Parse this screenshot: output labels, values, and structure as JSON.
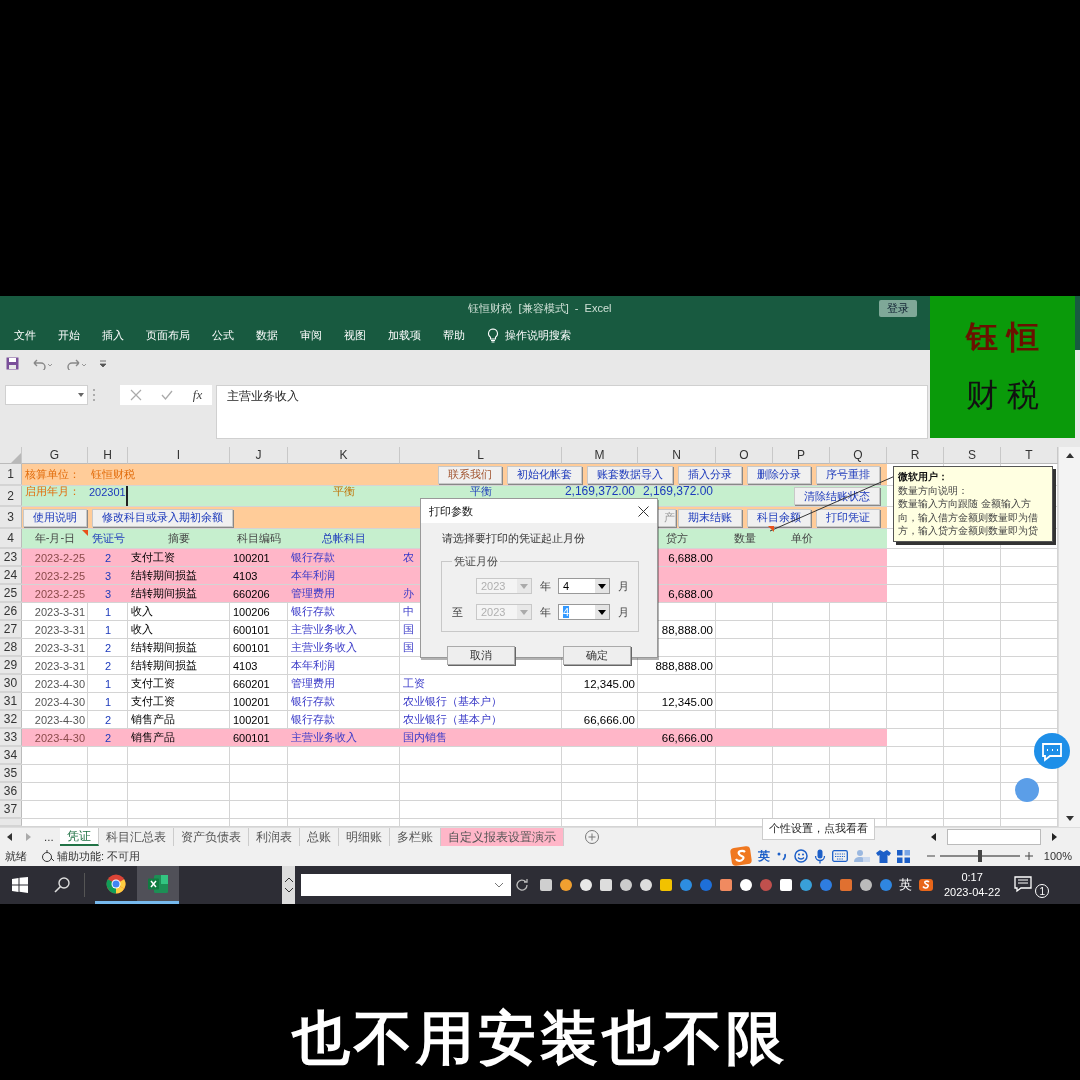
{
  "title_bar": {
    "title": "钰恒财税  [兼容模式]  -  Excel",
    "login": "登录"
  },
  "menu": {
    "items": [
      "文件",
      "开始",
      "插入",
      "页面布局",
      "公式",
      "数据",
      "审阅",
      "视图",
      "加载项",
      "帮助"
    ],
    "tell_me": "操作说明搜索"
  },
  "logo": {
    "line1": "钰 恒",
    "line2": "财 税"
  },
  "formula_bar": {
    "fx": "fx",
    "formula": "主营业务收入"
  },
  "columns": [
    "G",
    "H",
    "I",
    "J",
    "K",
    "L",
    "M",
    "N",
    "O",
    "P",
    "Q",
    "R",
    "S",
    "T"
  ],
  "row1": {
    "number": "1",
    "label": "核算单位：",
    "value": "钰恒财税",
    "buttons": [
      "联系我们",
      "初始化帐套",
      "账套数据导入",
      "插入分录",
      "删除分录",
      "序号重排"
    ]
  },
  "row2": {
    "number": "2",
    "label": "启用年月：",
    "value": "202301",
    "balance_k": "平衡",
    "balance_l": "平衡",
    "debit_total": "2,169,372.00",
    "credit_total": "2,169,372.00",
    "button": "清除结账状态"
  },
  "row3": {
    "number": "3",
    "left_buttons": [
      "使用说明",
      "修改科目或录入期初余额"
    ],
    "right_buttons": [
      "产",
      "期末结账",
      "科目余额",
      "打印凭证"
    ]
  },
  "row4": {
    "number": "4",
    "headers_left": [
      {
        "text": "年-月-日",
        "kind": "plain"
      },
      {
        "text": "凭证号",
        "kind": "link"
      },
      {
        "text": "摘要",
        "kind": "plain"
      },
      {
        "text": "科目编码",
        "kind": "plain"
      },
      {
        "text": "总帐科目",
        "kind": "link"
      }
    ],
    "headers_right": [
      {
        "text": "贷方",
        "kind": "plain"
      },
      {
        "text": "数量",
        "kind": "plain"
      },
      {
        "text": "单价",
        "kind": "plain"
      }
    ]
  },
  "entries": [
    {
      "number": "23",
      "highlighted": true,
      "date": "2023-2-25",
      "voucher": "2",
      "summary": "支付工资",
      "code": "100201",
      "account": "银行存款",
      "detail": "农",
      "credit": "6,688.00"
    },
    {
      "number": "24",
      "highlighted": true,
      "date": "2023-2-25",
      "voucher": "3",
      "summary": "结转期间损益",
      "code": "4103",
      "account": "本年利润"
    },
    {
      "number": "25",
      "highlighted": true,
      "date": "2023-2-25",
      "voucher": "3",
      "summary": "结转期间损益",
      "code": "660206",
      "account": "管理费用",
      "detail": "办",
      "credit": "6,688.00"
    },
    {
      "number": "26",
      "highlighted": false,
      "date": "2023-3-31",
      "voucher": "1",
      "summary": "收入",
      "code": "100206",
      "account": "银行存款",
      "detail": "中"
    },
    {
      "number": "27",
      "highlighted": false,
      "date": "2023-3-31",
      "voucher": "1",
      "summary": "收入",
      "code": "600101",
      "account": "主营业务收入",
      "detail": "国",
      "credit": "88,888.00"
    },
    {
      "number": "28",
      "highlighted": false,
      "date": "2023-3-31",
      "voucher": "2",
      "summary": "结转期间损益",
      "code": "600101",
      "account": "主营业务收入",
      "detail": "国"
    },
    {
      "number": "29",
      "highlighted": false,
      "date": "2023-3-31",
      "voucher": "2",
      "summary": "结转期间损益",
      "code": "4103",
      "account": "本年利润",
      "credit": "888,888.00"
    },
    {
      "number": "30",
      "highlighted": false,
      "date": "2023-4-30",
      "voucher": "1",
      "summary": "支付工资",
      "code": "660201",
      "account": "管理费用",
      "detail": "工资",
      "debit": "12,345.00"
    },
    {
      "number": "31",
      "highlighted": false,
      "date": "2023-4-30",
      "voucher": "1",
      "summary": "支付工资",
      "code": "100201",
      "account": "银行存款",
      "detail": "农业银行（基本户）",
      "credit": "12,345.00"
    },
    {
      "number": "32",
      "highlighted": false,
      "date": "2023-4-30",
      "voucher": "2",
      "summary": "销售产品",
      "code": "100201",
      "account": "银行存款",
      "detail": "农业银行（基本户）",
      "debit": "66,666.00"
    },
    {
      "number": "33",
      "highlighted": true,
      "date": "2023-4-30",
      "voucher": "2",
      "summary": "销售产品",
      "code": "600101",
      "account": "主营业务收入",
      "detail": "国内销售",
      "credit": "66,666.00"
    }
  ],
  "empty_rows": [
    "34",
    "35",
    "36",
    "37"
  ],
  "comment": {
    "author": "微软用户：",
    "heading": "数量方向说明：",
    "body": "数量输入方向跟随 金额输入方向，输入借方金额则数量即为借方，输入贷方金额则数量即为贷"
  },
  "dialog": {
    "title": "打印参数",
    "prompt": "请选择要打印的凭证起止月份",
    "group": "凭证月份",
    "ranges": [
      {
        "year": {
          "value": "2023",
          "disabled": true
        },
        "year_unit": "年",
        "month": {
          "value": "4",
          "disabled": false,
          "highlighted": false
        },
        "month_unit": "月"
      },
      {
        "prefix": "至",
        "year": {
          "value": "2023",
          "disabled": true
        },
        "year_unit": "年",
        "month": {
          "value": "4",
          "disabled": false,
          "highlighted": true
        },
        "month_unit": "月"
      }
    ],
    "buttons": [
      "取消",
      "确定"
    ]
  },
  "sheet_tabs": {
    "more": "...",
    "tabs": [
      {
        "label": "凭证",
        "selected": true
      },
      {
        "label": "科目汇总表",
        "selected": false
      },
      {
        "label": "资产负债表",
        "selected": false
      },
      {
        "label": "利润表",
        "selected": false
      },
      {
        "label": "总账",
        "selected": false
      },
      {
        "label": "明细账",
        "selected": false
      },
      {
        "label": "多栏账",
        "selected": false
      },
      {
        "label": "自定义报表设置演示",
        "selected": false,
        "color": "#ffb6c8"
      }
    ]
  },
  "tooltip": "个性设置，点我看看",
  "status_bar": {
    "ready": "就绪",
    "accessibility": "辅助功能: 不可用",
    "ime_mode": "英",
    "zoom_slider": {
      "level": 0.5
    },
    "zoom": "100%"
  },
  "taskbar": {
    "apps": [
      {
        "kind": "chrome",
        "active": false
      },
      {
        "kind": "excel",
        "active": true
      }
    ],
    "ime": "英",
    "time": "0:17",
    "date": "2023-04-22",
    "notifications": "1"
  },
  "subtitle": "也不用安装也不限"
}
